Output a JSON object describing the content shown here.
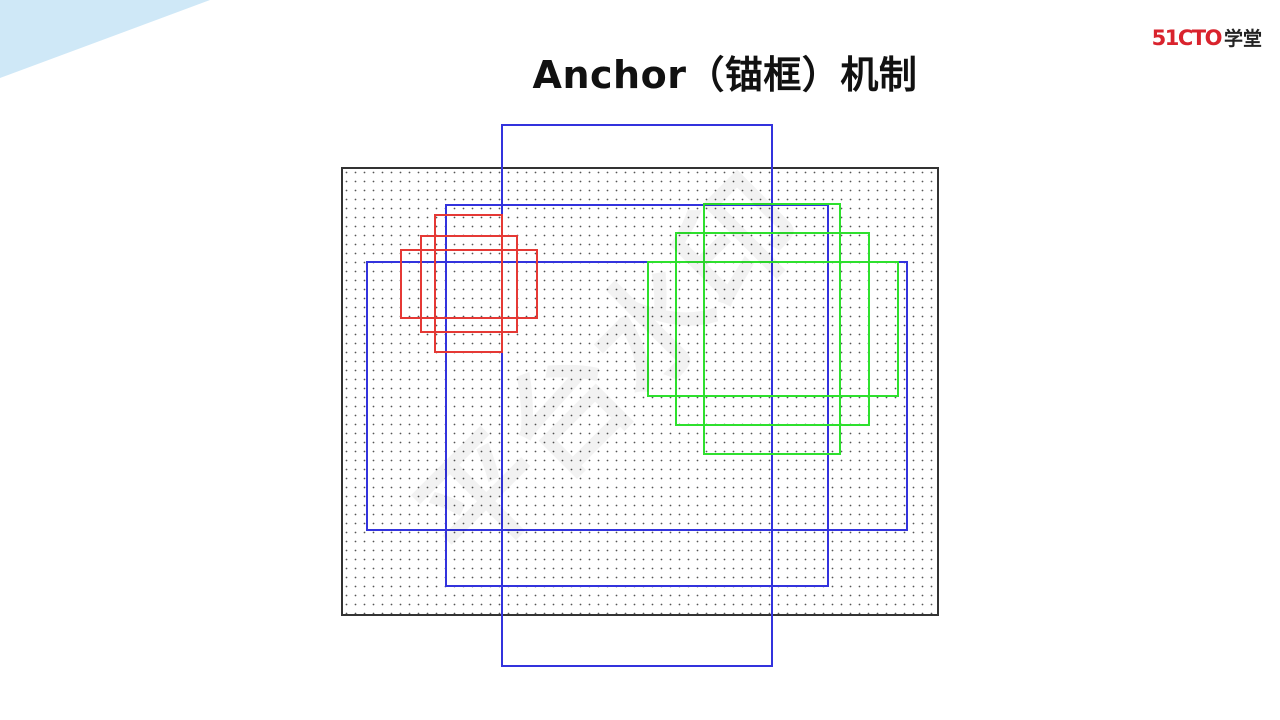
{
  "slide": {
    "title": "Anchor（锚框）机制",
    "logo": {
      "mark": "51CTO",
      "text": "学堂"
    },
    "watermark": "平台水印"
  },
  "colors": {
    "accent_corner": "#cfe8f7",
    "logo_red": "#d9232d",
    "grid_border": "#333333",
    "grid_dot": "#555555",
    "anchor_small": "#e53935",
    "anchor_medium": "#2ee02e",
    "anchor_large": "#3333dd"
  },
  "diagram": {
    "description_type": "anchor-box illustration",
    "anchor_groups": [
      {
        "name": "small",
        "color_key": "anchor_small",
        "count": 3
      },
      {
        "name": "medium",
        "color_key": "anchor_medium",
        "count": 3
      },
      {
        "name": "large",
        "color_key": "anchor_large",
        "count": 3
      }
    ]
  }
}
